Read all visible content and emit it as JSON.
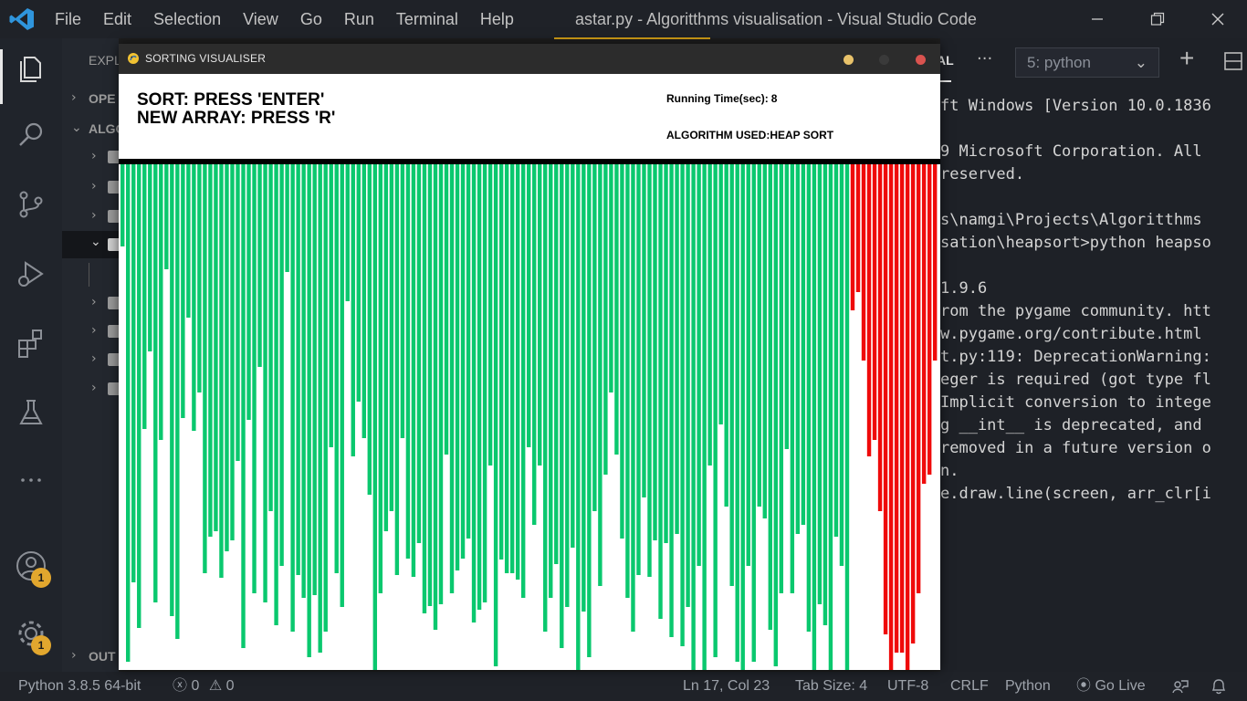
{
  "vscode": {
    "menu": [
      "File",
      "Edit",
      "Selection",
      "View",
      "Go",
      "Run",
      "Terminal",
      "Help"
    ],
    "window_title": "astar.py - Algoritthms visualisation - Visual Studio Code",
    "activity_badges": [
      "1",
      "1"
    ],
    "sidebar": {
      "header": "EXPL",
      "sections": [
        "OPE",
        "ALGO"
      ],
      "bottom_section": "OUT"
    },
    "panel": {
      "tab_fragment": "AL",
      "more": "···",
      "terminal_select": "5: python",
      "add": "+",
      "lines": [
        "ft Windows [Version 10.0.1836",
        "",
        "9 Microsoft Corporation. All",
        "reserved.",
        "",
        "s\\namgi\\Projects\\Algoritthms",
        "sation\\heapsort>python heapso",
        "",
        "1.9.6",
        "rom the pygame community. htt",
        "w.pygame.org/contribute.html",
        "t.py:119: DeprecationWarning:",
        "eger is required (got type fl",
        "Implicit conversion to intege",
        "g __int__ is deprecated, and",
        "removed in a future version o",
        "n.",
        "e.draw.line(screen, arr_clr[i"
      ]
    },
    "status": {
      "python": "Python 3.8.5 64-bit",
      "errors": "0",
      "warnings": "0",
      "position": "Ln 17, Col 23",
      "tab_size": "Tab Size: 4",
      "encoding": "UTF-8",
      "eol": "CRLF",
      "language": "Python",
      "golive": "Go Live"
    }
  },
  "pygame": {
    "title": "SORTING VISUALISER",
    "dot_colors": [
      "#e8c26a",
      "#3a3a3a",
      "#d9534f"
    ],
    "instruction_1": "SORT: PRESS 'ENTER'",
    "instruction_2": "NEW ARRAY: PRESS 'R'",
    "running_time_label": "Running Time(sec):",
    "running_time_value": "8",
    "algorithm_label": "ALGORITHM USED:",
    "algorithm_value": "HEAP SORT",
    "colors": {
      "unsorted": "#0ac86e",
      "sorted": "#ef0a0a",
      "divider": "#000000",
      "background": "#ffffff"
    },
    "chart_data": {
      "type": "bar",
      "sorted_from_index": 133,
      "max_value": 554,
      "values": [
        90,
        545,
        458,
        508,
        290,
        205,
        480,
        302,
        115,
        495,
        520,
        278,
        168,
        292,
        250,
        448,
        408,
        402,
        453,
        424,
        412,
        325,
        530,
        280,
        470,
        222,
        480,
        380,
        505,
        440,
        118,
        512,
        450,
        475,
        540,
        472,
        535,
        512,
        310,
        448,
        485,
        150,
        320,
        260,
        300,
        362,
        565,
        470,
        402,
        380,
        450,
        300,
        432,
        452,
        415,
        492,
        484,
        510,
        482,
        318,
        470,
        445,
        432,
        410,
        502,
        488,
        480,
        330,
        550,
        433,
        448,
        448,
        455,
        475,
        310,
        395,
        330,
        512,
        475,
        438,
        530,
        485,
        420,
        560,
        490,
        540,
        380,
        462,
        340,
        250,
        318,
        410,
        475,
        512,
        450,
        365,
        452,
        412,
        498,
        415,
        518,
        405,
        528,
        485,
        570,
        440,
        590,
        330,
        540,
        285,
        375,
        462,
        545,
        595,
        440,
        545,
        375,
        388,
        510,
        550,
        470,
        312,
        470,
        405,
        395,
        512,
        588,
        482,
        505,
        595,
        408,
        440,
        568,
        160,
        140,
        215,
        320,
        302,
        380,
        515,
        560,
        535,
        535,
        555,
        525,
        470,
        350,
        340,
        215
      ]
    }
  }
}
